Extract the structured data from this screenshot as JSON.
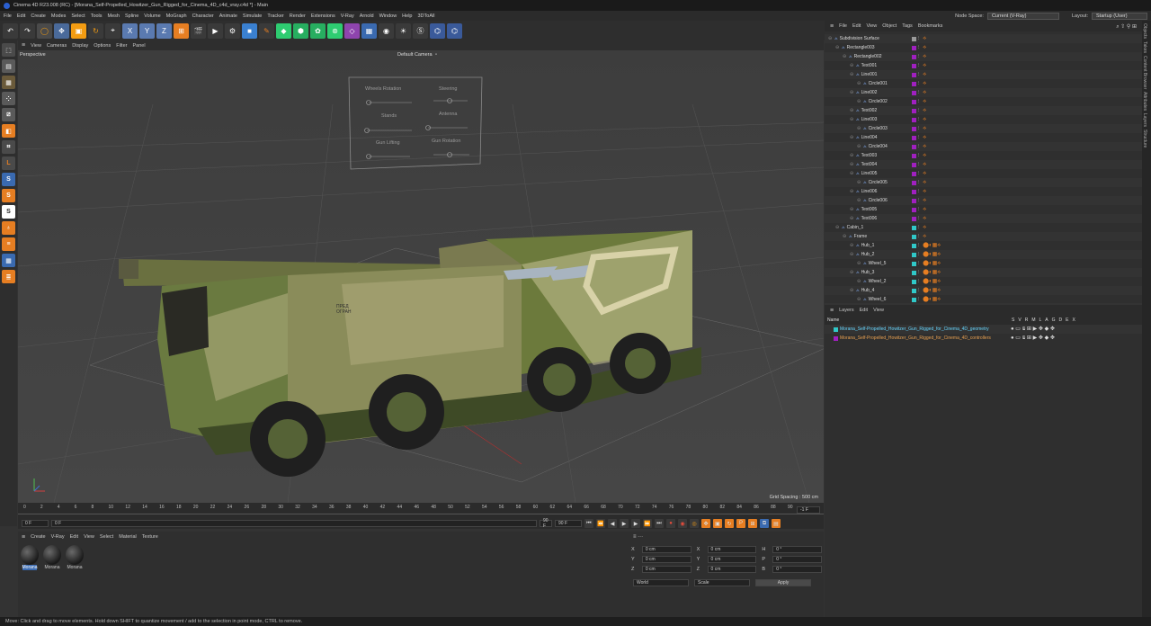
{
  "title_bar": {
    "text": "Cinema 4D R23.008 (RC) - [Morana_Self-Propelled_Howitzer_Gun_Rigged_for_Cinema_4D_c4d_vray.c4d *] - Main"
  },
  "menu": [
    "File",
    "Edit",
    "Create",
    "Modes",
    "Select",
    "Tools",
    "Mesh",
    "Spline",
    "Volume",
    "MoGraph",
    "Character",
    "Animate",
    "Simulate",
    "Tracker",
    "Render",
    "Extensions",
    "V-Ray",
    "Arnold",
    "Window",
    "Help",
    "3DToAll"
  ],
  "node_space": {
    "label": "Node Space:",
    "value": "Current (V-Ray)"
  },
  "layout": {
    "label": "Layout:",
    "value": "Startup (User)"
  },
  "viewport_menu": [
    "View",
    "Cameras",
    "Display",
    "Options",
    "Filter",
    "Panel"
  ],
  "viewport": {
    "view_name": "Perspective",
    "camera": "Default Camera",
    "grid_spacing": "Grid Spacing : 500 cm",
    "controller_labels": [
      "Wheels Rotation",
      "Steering",
      "Stands",
      "Antenna",
      "Gun Lifting",
      "Gun Rotation"
    ],
    "decal": "ПРЕД ОГРАН"
  },
  "timeline": {
    "ticks": [
      "0",
      "2",
      "4",
      "6",
      "8",
      "10",
      "12",
      "14",
      "16",
      "18",
      "20",
      "22",
      "24",
      "26",
      "28",
      "30",
      "32",
      "34",
      "36",
      "38",
      "40",
      "42",
      "44",
      "46",
      "48",
      "50",
      "52",
      "54",
      "56",
      "58",
      "60",
      "62",
      "64",
      "66",
      "68",
      "70",
      "72",
      "74",
      "76",
      "78",
      "80",
      "82",
      "84",
      "86",
      "88",
      "90"
    ],
    "current_frame": "-1 F",
    "start": "0 F",
    "start2": "0 F",
    "end": "90 F",
    "end2": "90 F"
  },
  "material_menu": [
    "Create",
    "V-Ray",
    "Edit",
    "View",
    "Select",
    "Material",
    "Texture"
  ],
  "materials": [
    "Morana",
    "Morana",
    "Morana"
  ],
  "coords": {
    "rows": [
      {
        "a": "X",
        "av": "0 cm",
        "b": "X",
        "bv": "0 cm",
        "c": "H",
        "cv": "0 °"
      },
      {
        "a": "Y",
        "av": "0 cm",
        "b": "Y",
        "bv": "0 cm",
        "c": "P",
        "cv": "0 °"
      },
      {
        "a": "Z",
        "av": "0 cm",
        "b": "Z",
        "bv": "0 cm",
        "c": "B",
        "cv": "0 °"
      }
    ],
    "world": "World",
    "scale": "Scale",
    "apply": "Apply"
  },
  "status": "Move: Click and drag to move elements. Hold down SHIFT to quantize movement / add to the selection in point mode, CTRL to remove.",
  "object_menu": [
    "File",
    "Edit",
    "View",
    "Object",
    "Tags",
    "Bookmarks"
  ],
  "objects": [
    {
      "name": "Subdivision Surface",
      "level": 0,
      "color": "#9a9a9a"
    },
    {
      "name": "Rectangle003",
      "level": 1,
      "color": "#a020c0"
    },
    {
      "name": "Rectangle002",
      "level": 2,
      "color": "#a020c0"
    },
    {
      "name": "Text001",
      "level": 3,
      "color": "#a020c0"
    },
    {
      "name": "Line001",
      "level": 3,
      "color": "#a020c0"
    },
    {
      "name": "Circle001",
      "level": 4,
      "color": "#a020c0"
    },
    {
      "name": "Line002",
      "level": 3,
      "color": "#a020c0"
    },
    {
      "name": "Circle002",
      "level": 4,
      "color": "#a020c0"
    },
    {
      "name": "Text002",
      "level": 3,
      "color": "#a020c0"
    },
    {
      "name": "Line003",
      "level": 3,
      "color": "#a020c0"
    },
    {
      "name": "Circle003",
      "level": 4,
      "color": "#a020c0"
    },
    {
      "name": "Line004",
      "level": 3,
      "color": "#a020c0"
    },
    {
      "name": "Circle004",
      "level": 4,
      "color": "#a020c0"
    },
    {
      "name": "Text003",
      "level": 3,
      "color": "#a020c0"
    },
    {
      "name": "Text004",
      "level": 3,
      "color": "#a020c0"
    },
    {
      "name": "Line005",
      "level": 3,
      "color": "#a020c0"
    },
    {
      "name": "Circle005",
      "level": 4,
      "color": "#a020c0"
    },
    {
      "name": "Line006",
      "level": 3,
      "color": "#a020c0"
    },
    {
      "name": "Circle006",
      "level": 4,
      "color": "#a020c0"
    },
    {
      "name": "Text005",
      "level": 3,
      "color": "#a020c0"
    },
    {
      "name": "Text006",
      "level": 3,
      "color": "#a020c0"
    },
    {
      "name": "Cabin_1",
      "level": 1,
      "color": "#30c8c8"
    },
    {
      "name": "Frame",
      "level": 2,
      "color": "#30c8c8"
    },
    {
      "name": "Hub_1",
      "level": 3,
      "color": "#30c8c8"
    },
    {
      "name": "Hub_2",
      "level": 3,
      "color": "#30c8c8"
    },
    {
      "name": "Wheel_5",
      "level": 4,
      "color": "#30c8c8"
    },
    {
      "name": "Hub_3",
      "level": 3,
      "color": "#30c8c8"
    },
    {
      "name": "Wheel_2",
      "level": 4,
      "color": "#30c8c8"
    },
    {
      "name": "Hub_4",
      "level": 3,
      "color": "#30c8c8"
    },
    {
      "name": "Wheel_6",
      "level": 4,
      "color": "#30c8c8"
    }
  ],
  "layer_menu": [
    "Layers",
    "Edit",
    "View"
  ],
  "layer_header": {
    "name": "Name",
    "flags": [
      "S",
      "V",
      "R",
      "M",
      "L",
      "A",
      "G",
      "D",
      "E",
      "X"
    ]
  },
  "layers": [
    {
      "name": "Morana_Self-Propelled_Howitzer_Gun_Rigged_for_Cinema_4D_geometry",
      "color": "#30c8c8",
      "text_color": "#66d6ff"
    },
    {
      "name": "Morana_Self-Propelled_Howitzer_Gun_Rigged_for_Cinema_4D_controllers",
      "color": "#a020c0",
      "text_color": "#e8a050"
    }
  ],
  "side_tabs": [
    "Objects",
    "Takes",
    "Content Browser",
    "Attributes",
    "Layers",
    "Structure"
  ]
}
